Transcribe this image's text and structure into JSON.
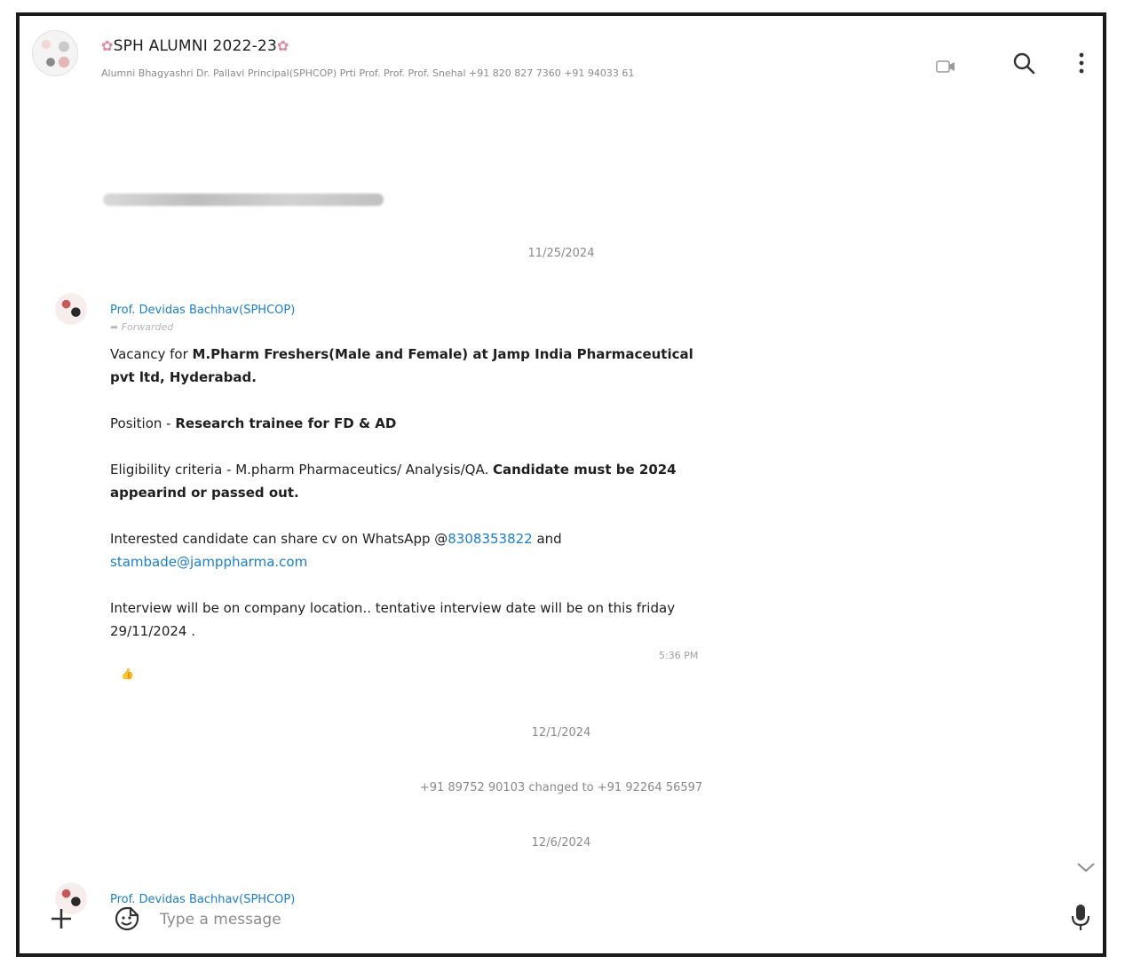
{
  "header": {
    "title": "SPH ALUMNI 2022-23",
    "members": "Alumni Bhagyashri Dr. Pallavi Principal(SPHCOP) Prti Prof. Prof. Prof. Snehal +91 820 827 7360 +91 94033 61"
  },
  "chat": {
    "date1": "11/25/2024",
    "message1": {
      "sender": "Prof. Devidas Bachhav(SPHCOP)",
      "forwarded": "Forwarded",
      "line1_a": "Vacancy for ",
      "line1_b": "M.Pharm Freshers(Male and Female) at Jamp India Pharmaceutical pvt ltd, Hyderabad.",
      "position_label": "Position - ",
      "position_value": "Research trainee for FD & AD",
      "elig_label": "Eligibility criteria - M.pharm Pharmaceutics/ Analysis/QA. ",
      "elig_bold": "Candidate must be 2024 appearind or passed out.",
      "share_text": "Interested candidate can share cv on WhatsApp @",
      "phone_link": "8308353822",
      "and_text": " and",
      "email_link": "stambade@jamppharma.com",
      "interview_text": "Interview will be on company location.. tentative interview date will be on this friday 29/11/2024 .",
      "time": "5:36 PM",
      "reaction": "👍"
    },
    "date2": "12/1/2024",
    "system_message": "+91 89752 90103 changed to +91 92264 56597",
    "date3": "12/6/2024",
    "message2": {
      "sender": "Prof. Devidas Bachhav(SPHCOP)"
    }
  },
  "composer": {
    "placeholder": "Type a message"
  }
}
